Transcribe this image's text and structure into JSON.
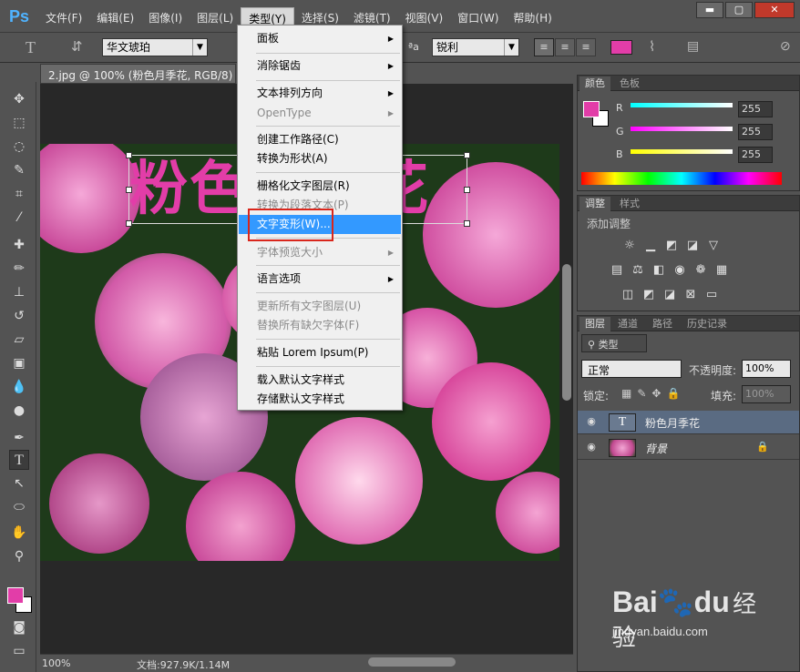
{
  "app": {
    "logo_text": "Ps"
  },
  "menubar": {
    "items": [
      "文件(F)",
      "编辑(E)",
      "图像(I)",
      "图层(L)",
      "类型(Y)",
      "选择(S)",
      "滤镜(T)",
      "视图(V)",
      "窗口(W)",
      "帮助(H)"
    ],
    "active_index": 4,
    "window_buttons": [
      "▬",
      "▢",
      "✕"
    ]
  },
  "options": {
    "font_family": "华文琥珀",
    "aa_label": "ªa",
    "aa_mode": "锐利",
    "text_color": "#e23da8"
  },
  "document": {
    "tab_title": "2.jpg @ 100% (粉色月季花, RGB/8) *",
    "canvas_text": "粉色月季花",
    "zoom": "100%",
    "doc_size": "文档:927.9K/1.14M"
  },
  "type_menu": {
    "items": [
      {
        "label": "面板",
        "submenu": true,
        "disabled": false
      },
      {
        "label": "消除锯齿",
        "submenu": true,
        "disabled": false
      },
      {
        "label": "文本排列方向",
        "submenu": true,
        "disabled": false
      },
      {
        "label": "OpenType",
        "submenu": true,
        "disabled": true
      },
      {
        "label": "创建工作路径(C)",
        "submenu": false,
        "disabled": false
      },
      {
        "label": "转换为形状(A)",
        "submenu": false,
        "disabled": false
      },
      {
        "label": "栅格化文字图层(R)",
        "submenu": false,
        "disabled": false
      },
      {
        "label": "转换为段落文本(P)",
        "submenu": false,
        "disabled": true
      },
      {
        "label": "文字变形(W)...",
        "submenu": false,
        "disabled": false,
        "highlighted": true
      },
      {
        "label": "字体预览大小",
        "submenu": true,
        "disabled": true
      },
      {
        "label": "语言选项",
        "submenu": true,
        "disabled": false
      },
      {
        "label": "更新所有文字图层(U)",
        "submenu": false,
        "disabled": true
      },
      {
        "label": "替换所有缺欠字体(F)",
        "submenu": false,
        "disabled": true
      },
      {
        "label": "粘贴 Lorem Ipsum(P)",
        "submenu": false,
        "disabled": false
      },
      {
        "label": "载入默认文字样式",
        "submenu": false,
        "disabled": false
      },
      {
        "label": "存储默认文字样式",
        "submenu": false,
        "disabled": false
      }
    ]
  },
  "color_panel": {
    "tabs": [
      "颜色",
      "色板"
    ],
    "channels": [
      {
        "label": "R",
        "value": "255"
      },
      {
        "label": "G",
        "value": "255"
      },
      {
        "label": "B",
        "value": "255"
      }
    ],
    "foreground": "#e23da8"
  },
  "adjust_panel": {
    "tabs": [
      "调整",
      "样式"
    ],
    "title": "添加调整"
  },
  "layers_panel": {
    "tabs": [
      "图层",
      "通道",
      "路径",
      "历史记录"
    ],
    "filter": "类型",
    "blend_mode": "正常",
    "opacity_label": "不透明度:",
    "opacity": "100%",
    "lock_label": "锁定:",
    "fill_label": "填充:",
    "fill": "100%",
    "layers": [
      {
        "name": "粉色月季花",
        "type": "text",
        "selected": true
      },
      {
        "name": "背景",
        "type": "image",
        "selected": false
      }
    ]
  },
  "watermark": {
    "brand": "Bai",
    "brand2": "du",
    "sub": "经验",
    "url": "jingyan.baidu.com"
  }
}
